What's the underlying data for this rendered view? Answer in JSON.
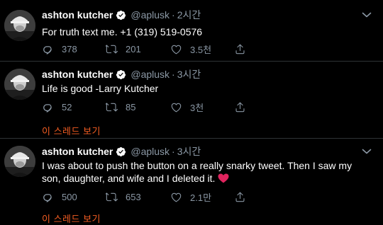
{
  "colors": {
    "background": "#000000",
    "text": "#ffffff",
    "secondary": "#8b98a5",
    "accent": "#f45d22",
    "verified": "#ffffff",
    "heart_emoji": "#e0245e"
  },
  "tweets": [
    {
      "name": "ashton kutcher",
      "handle": "@aplusk",
      "separator": "·",
      "time": "2시간",
      "text": "For truth text me. +1 (319) 519-0576",
      "replies": "378",
      "retweets": "201",
      "likes": "3.5천"
    },
    {
      "name": "ashton kutcher",
      "handle": "@aplusk",
      "separator": "·",
      "time": "3시간",
      "text": "Life is good -Larry Kutcher",
      "replies": "52",
      "retweets": "85",
      "likes": "3천",
      "thread_link": "이 스레드 보기"
    },
    {
      "name": "ashton kutcher",
      "handle": "@aplusk",
      "separator": "·",
      "time": "3시간",
      "text": "I was about to push the button on a really snarky tweet. Then I saw my son, daughter, and wife and I deleted it.",
      "emoji": "red-heart-emoji",
      "replies": "500",
      "retweets": "653",
      "likes": "2.1만",
      "thread_link": "이 스레드 보기"
    }
  ],
  "icons": {
    "reply": "reply-icon",
    "retweet": "retweet-icon",
    "like": "like-icon",
    "share": "share-icon",
    "more": "chevron-down-icon",
    "verified": "verified-badge-icon"
  }
}
